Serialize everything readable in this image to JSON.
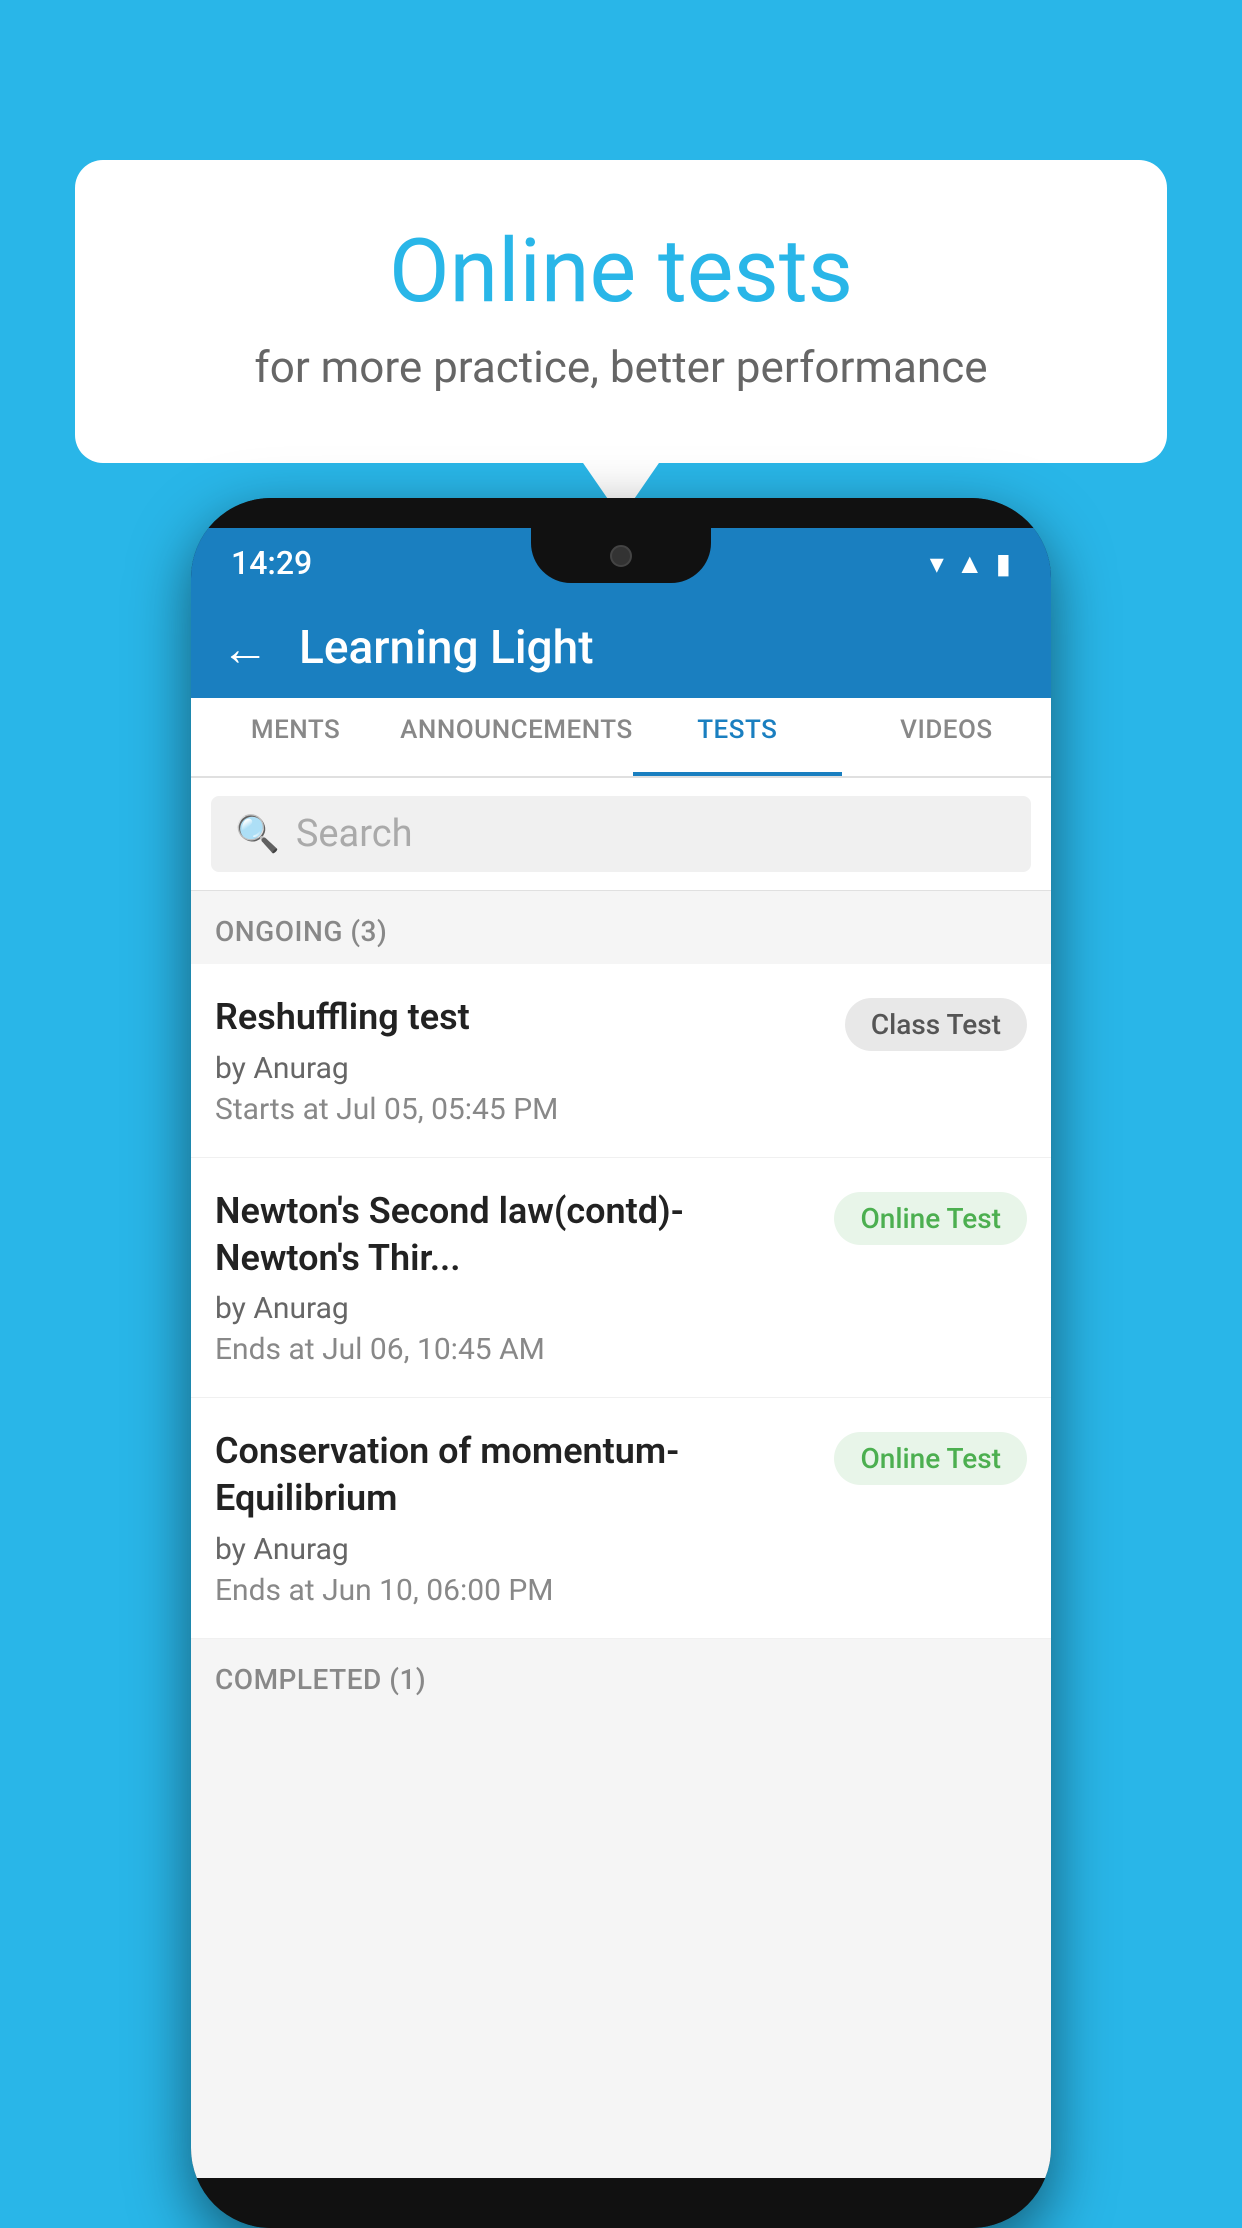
{
  "background": {
    "color": "#29b6e8"
  },
  "bubble": {
    "title": "Online tests",
    "subtitle": "for more practice, better performance"
  },
  "phone": {
    "status_bar": {
      "time": "14:29"
    },
    "app_bar": {
      "title": "Learning Light",
      "back_icon": "←"
    },
    "tabs": [
      {
        "label": "MENTS",
        "active": false
      },
      {
        "label": "ANNOUNCEMENTS",
        "active": false
      },
      {
        "label": "TESTS",
        "active": true
      },
      {
        "label": "VIDEOS",
        "active": false
      }
    ],
    "search": {
      "placeholder": "Search"
    },
    "sections": [
      {
        "header": "ONGOING (3)",
        "tests": [
          {
            "title": "Reshuffling test",
            "author": "by Anurag",
            "date_label": "Starts at",
            "date": "Jul 05, 05:45 PM",
            "badge": "Class Test",
            "badge_type": "class"
          },
          {
            "title": "Newton's Second law(contd)-Newton's Thir...",
            "author": "by Anurag",
            "date_label": "Ends at",
            "date": "Jul 06, 10:45 AM",
            "badge": "Online Test",
            "badge_type": "online"
          },
          {
            "title": "Conservation of momentum-Equilibrium",
            "author": "by Anurag",
            "date_label": "Ends at",
            "date": "Jun 10, 06:00 PM",
            "badge": "Online Test",
            "badge_type": "online"
          }
        ]
      }
    ],
    "completed_header": "COMPLETED (1)"
  }
}
